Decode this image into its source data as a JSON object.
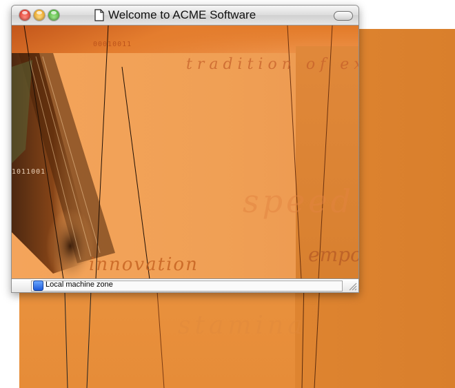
{
  "window": {
    "title": "Welcome to ACME Software"
  },
  "content": {
    "binary_top": "00010011",
    "binary_left": "1011001",
    "phrase_tradition": "tradition of excellence",
    "phrase_speed": "speed",
    "phrase_empowering": "empowering",
    "phrase_innovation": "innovation"
  },
  "background": {
    "phrase_stamina": "stamina"
  },
  "statusbar": {
    "zone_label": "Local machine zone"
  },
  "icons": {
    "document": "document-icon",
    "zone": "globe-zone-icon",
    "resize": "resize-grip-icon"
  },
  "colors": {
    "accent_orange": "#ee9a45",
    "close": "#d62a1e",
    "minimize": "#e79a10",
    "zoom": "#3ea82a"
  }
}
